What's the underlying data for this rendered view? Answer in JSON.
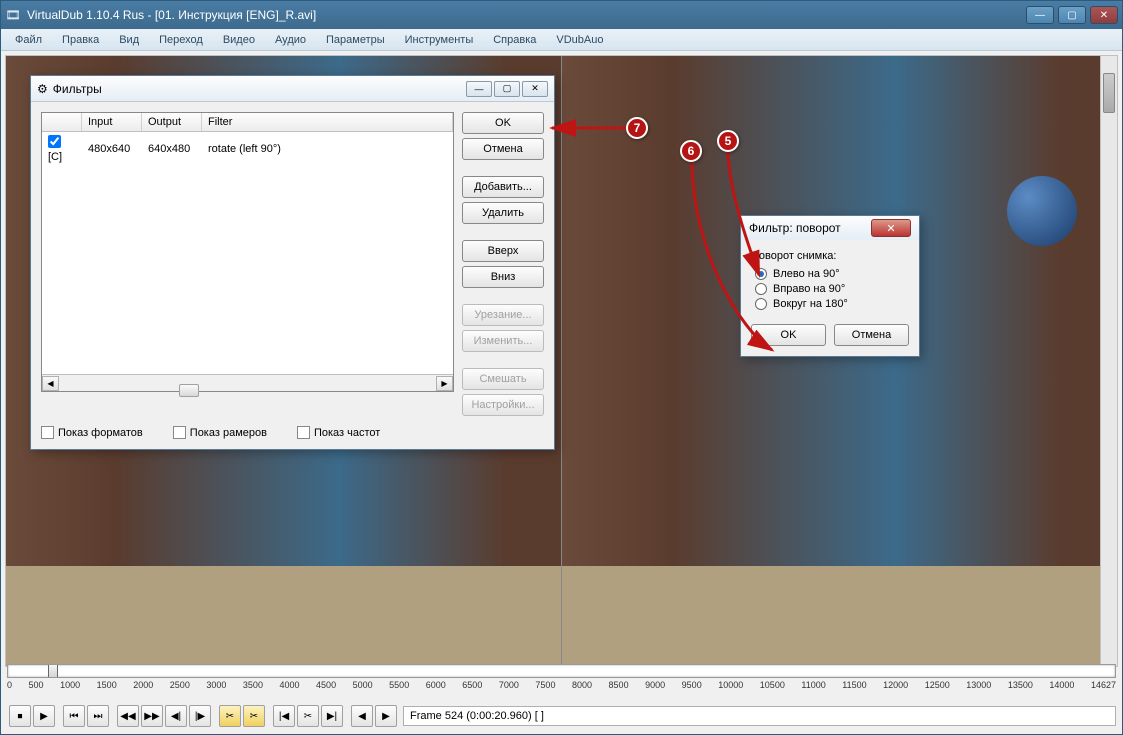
{
  "window": {
    "title": "VirtualDub 1.10.4 Rus - [01. Инструкция [ENG]_R.avi]"
  },
  "menu": {
    "file": "Файл",
    "edit": "Правка",
    "view": "Вид",
    "go": "Переход",
    "video": "Видео",
    "audio": "Аудио",
    "options": "Параметры",
    "tools": "Инструменты",
    "help": "Справка",
    "vdubauo": "VDubAuo"
  },
  "filters_dialog": {
    "title": "Фильтры",
    "columns": {
      "check": "",
      "input": "Input",
      "output": "Output",
      "filter": "Filter"
    },
    "row": {
      "tag": "[C]",
      "input": "480x640",
      "output": "640x480",
      "filter": "rotate (left 90°)"
    },
    "buttons": {
      "ok": "OK",
      "cancel": "Отмена",
      "add": "Добавить...",
      "remove": "Удалить",
      "up": "Вверх",
      "down": "Вниз",
      "crop": "Урезание...",
      "config": "Изменить...",
      "blend": "Смешать",
      "settings": "Настройки..."
    },
    "checks": {
      "formats": "Показ форматов",
      "sizes": "Показ рамеров",
      "freq": "Показ частот"
    }
  },
  "rotate_dialog": {
    "title": "Фильтр: поворот",
    "group": "Поворот снимка:",
    "opt_left": "Влево на 90°",
    "opt_right": "Вправо на 90°",
    "opt_180": "Вокруг на 180°",
    "ok": "OK",
    "cancel": "Отмена"
  },
  "annotations": {
    "a5": "5",
    "a6": "6",
    "a7": "7"
  },
  "timeline": {
    "ticks": [
      "0",
      "500",
      "1000",
      "1500",
      "2000",
      "2500",
      "3000",
      "3500",
      "4000",
      "4500",
      "5000",
      "5500",
      "6000",
      "6500",
      "7000",
      "7500",
      "8000",
      "8500",
      "9000",
      "9500",
      "10000",
      "10500",
      "11000",
      "11500",
      "12000",
      "12500",
      "13000",
      "13500",
      "14000",
      "14627"
    ]
  },
  "status": "Frame 524 (0:00:20.960) [ ]",
  "toolbar_glyphs": [
    "⏹",
    "▶",
    "⏮",
    "⏭",
    "◀◀",
    "▶▶",
    "◀|",
    "|▶",
    "✂",
    "✂",
    "|◀",
    "✂",
    "▶|",
    "◀",
    "▶"
  ]
}
